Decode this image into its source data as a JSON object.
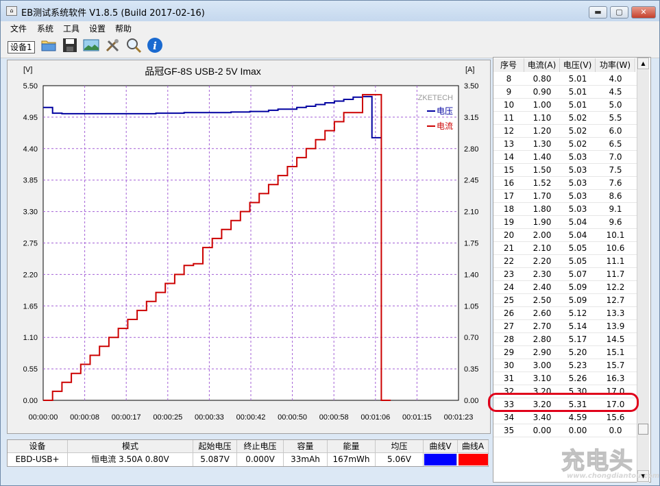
{
  "window": {
    "title": "EB测试系统软件 V1.8.5 (Build 2017-02-16)",
    "buttons": {
      "minimize": "▬",
      "maximize": "▢",
      "close": "✕"
    }
  },
  "menu": [
    "文件",
    "系统",
    "工具",
    "设置",
    "帮助"
  ],
  "toolbar": {
    "device_tab": "设备1",
    "icons": [
      "open-folder-icon",
      "save-disk-icon",
      "chart-image-icon",
      "tools-icon",
      "zoom-icon",
      "info-icon"
    ]
  },
  "chart_data": {
    "type": "line",
    "title": "品冠GF-8S USB-2  5V Imax",
    "brand": "ZKETECH",
    "ylabel_left": "[V]",
    "ylabel_right": "[A]",
    "ylim_left": [
      0,
      5.5
    ],
    "ylim_right": [
      0,
      3.5
    ],
    "yticks_left": [
      "5.50",
      "4.95",
      "4.40",
      "3.85",
      "3.30",
      "2.75",
      "2.20",
      "1.65",
      "1.10",
      "0.55",
      "0.00"
    ],
    "yticks_right": [
      "3.50",
      "3.15",
      "2.80",
      "2.45",
      "2.10",
      "1.75",
      "1.40",
      "1.05",
      "0.70",
      "0.35",
      "0.00"
    ],
    "xticks": [
      "00:00:00",
      "00:00:08",
      "00:00:17",
      "00:00:25",
      "00:00:33",
      "00:00:42",
      "00:00:50",
      "00:00:58",
      "00:01:06",
      "00:01:15",
      "00:01:23"
    ],
    "grid": true,
    "legend_position": "top-right",
    "series": [
      {
        "name": "电压",
        "color": "#0000a0",
        "axis": "left",
        "x": [
          0,
          1,
          2,
          3,
          4,
          5,
          6,
          7,
          8,
          9,
          10,
          11,
          12,
          13,
          14,
          15,
          16,
          17,
          18,
          19,
          20,
          21,
          22,
          23,
          24,
          25,
          26,
          27,
          28,
          29,
          30,
          31,
          32,
          33,
          34,
          35
        ],
        "values": [
          5.12,
          5.02,
          5.01,
          5.01,
          5.01,
          5.01,
          5.01,
          5.01,
          5.01,
          5.01,
          5.01,
          5.01,
          5.02,
          5.02,
          5.02,
          5.03,
          5.03,
          5.03,
          5.03,
          5.03,
          5.04,
          5.04,
          5.05,
          5.05,
          5.07,
          5.09,
          5.09,
          5.12,
          5.14,
          5.17,
          5.2,
          5.23,
          5.26,
          5.3,
          5.31,
          4.59
        ]
      },
      {
        "name": "电流",
        "color": "#cc0000",
        "axis": "right",
        "x": [
          0,
          1,
          2,
          3,
          4,
          5,
          6,
          7,
          8,
          9,
          10,
          11,
          12,
          13,
          14,
          15,
          16,
          17,
          18,
          19,
          20,
          21,
          22,
          23,
          24,
          25,
          26,
          27,
          28,
          29,
          30,
          31,
          32,
          33,
          34,
          35,
          36
        ],
        "values": [
          0.0,
          0.1,
          0.2,
          0.3,
          0.4,
          0.5,
          0.6,
          0.7,
          0.8,
          0.9,
          1.0,
          1.1,
          1.2,
          1.3,
          1.4,
          1.5,
          1.52,
          1.7,
          1.8,
          1.9,
          2.0,
          2.1,
          2.2,
          2.3,
          2.4,
          2.5,
          2.6,
          2.7,
          2.8,
          2.9,
          3.0,
          3.1,
          3.2,
          3.2,
          3.4,
          3.4,
          0.0
        ]
      }
    ]
  },
  "table": {
    "headers": [
      "序号",
      "电流(A)",
      "电压(V)",
      "功率(W)"
    ],
    "rows": [
      [
        "8",
        "0.80",
        "5.01",
        "4.0"
      ],
      [
        "9",
        "0.90",
        "5.01",
        "4.5"
      ],
      [
        "10",
        "1.00",
        "5.01",
        "5.0"
      ],
      [
        "11",
        "1.10",
        "5.02",
        "5.5"
      ],
      [
        "12",
        "1.20",
        "5.02",
        "6.0"
      ],
      [
        "13",
        "1.30",
        "5.02",
        "6.5"
      ],
      [
        "14",
        "1.40",
        "5.03",
        "7.0"
      ],
      [
        "15",
        "1.50",
        "5.03",
        "7.5"
      ],
      [
        "16",
        "1.52",
        "5.03",
        "7.6"
      ],
      [
        "17",
        "1.70",
        "5.03",
        "8.6"
      ],
      [
        "18",
        "1.80",
        "5.03",
        "9.1"
      ],
      [
        "19",
        "1.90",
        "5.04",
        "9.6"
      ],
      [
        "20",
        "2.00",
        "5.04",
        "10.1"
      ],
      [
        "21",
        "2.10",
        "5.05",
        "10.6"
      ],
      [
        "22",
        "2.20",
        "5.05",
        "11.1"
      ],
      [
        "23",
        "2.30",
        "5.07",
        "11.7"
      ],
      [
        "24",
        "2.40",
        "5.09",
        "12.2"
      ],
      [
        "25",
        "2.50",
        "5.09",
        "12.7"
      ],
      [
        "26",
        "2.60",
        "5.12",
        "13.3"
      ],
      [
        "27",
        "2.70",
        "5.14",
        "13.9"
      ],
      [
        "28",
        "2.80",
        "5.17",
        "14.5"
      ],
      [
        "29",
        "2.90",
        "5.20",
        "15.1"
      ],
      [
        "30",
        "3.00",
        "5.23",
        "15.7"
      ],
      [
        "31",
        "3.10",
        "5.26",
        "16.3"
      ],
      [
        "32",
        "3.20",
        "5.30",
        "17.0"
      ],
      [
        "33",
        "3.20",
        "5.31",
        "17.0"
      ],
      [
        "34",
        "3.40",
        "4.59",
        "15.6"
      ],
      [
        "35",
        "0.00",
        "0.00",
        "0.0"
      ]
    ],
    "highlighted_row": "33",
    "highlight_color": "#e0001a"
  },
  "summary": {
    "headers": [
      "设备",
      "模式",
      "起始电压",
      "终止电压",
      "容量",
      "能量",
      "均压",
      "曲线V",
      "曲线A"
    ],
    "values": [
      "EBD-USB+",
      "恒电流  3.50A  0.80V",
      "5.087V",
      "0.000V",
      "33mAh",
      "167mWh",
      "5.06V",
      "",
      ""
    ],
    "curve_v_color": "#0000ff",
    "curve_a_color": "#ff0000"
  },
  "watermark": {
    "text": "充电头",
    "url": "www.chongdiantou.com"
  }
}
